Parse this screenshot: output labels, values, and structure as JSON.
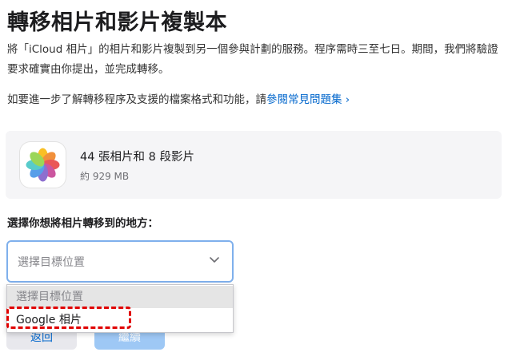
{
  "page": {
    "title": "轉移相片和影片複製本",
    "intro_text": "將「iCloud 相片」的相片和影片複製到另一個參與計劃的服務。程序需時三至七日。期間，我們將驗證要求確實由你提出，並完成轉移。",
    "faq_prefix": "如要進一步了解轉移程序及支援的檔案格式和功能，請",
    "faq_link": "參閱常見問題集 ›"
  },
  "summary": {
    "icon": "photos-app-icon",
    "count": "44 張相片和 8 段影片",
    "size": "約 929 MB"
  },
  "destination": {
    "label": "選擇你想將相片轉移到的地方：",
    "selected": "選擇目標位置",
    "options": [
      "選擇目標位置",
      "Google 相片"
    ]
  },
  "buttons": {
    "back": "返回",
    "next": "繼續"
  },
  "colors": {
    "link": "#0066cc",
    "focus_border": "#7fb0ec",
    "highlight": "#e00000",
    "card_bg": "#f5f5f7"
  }
}
